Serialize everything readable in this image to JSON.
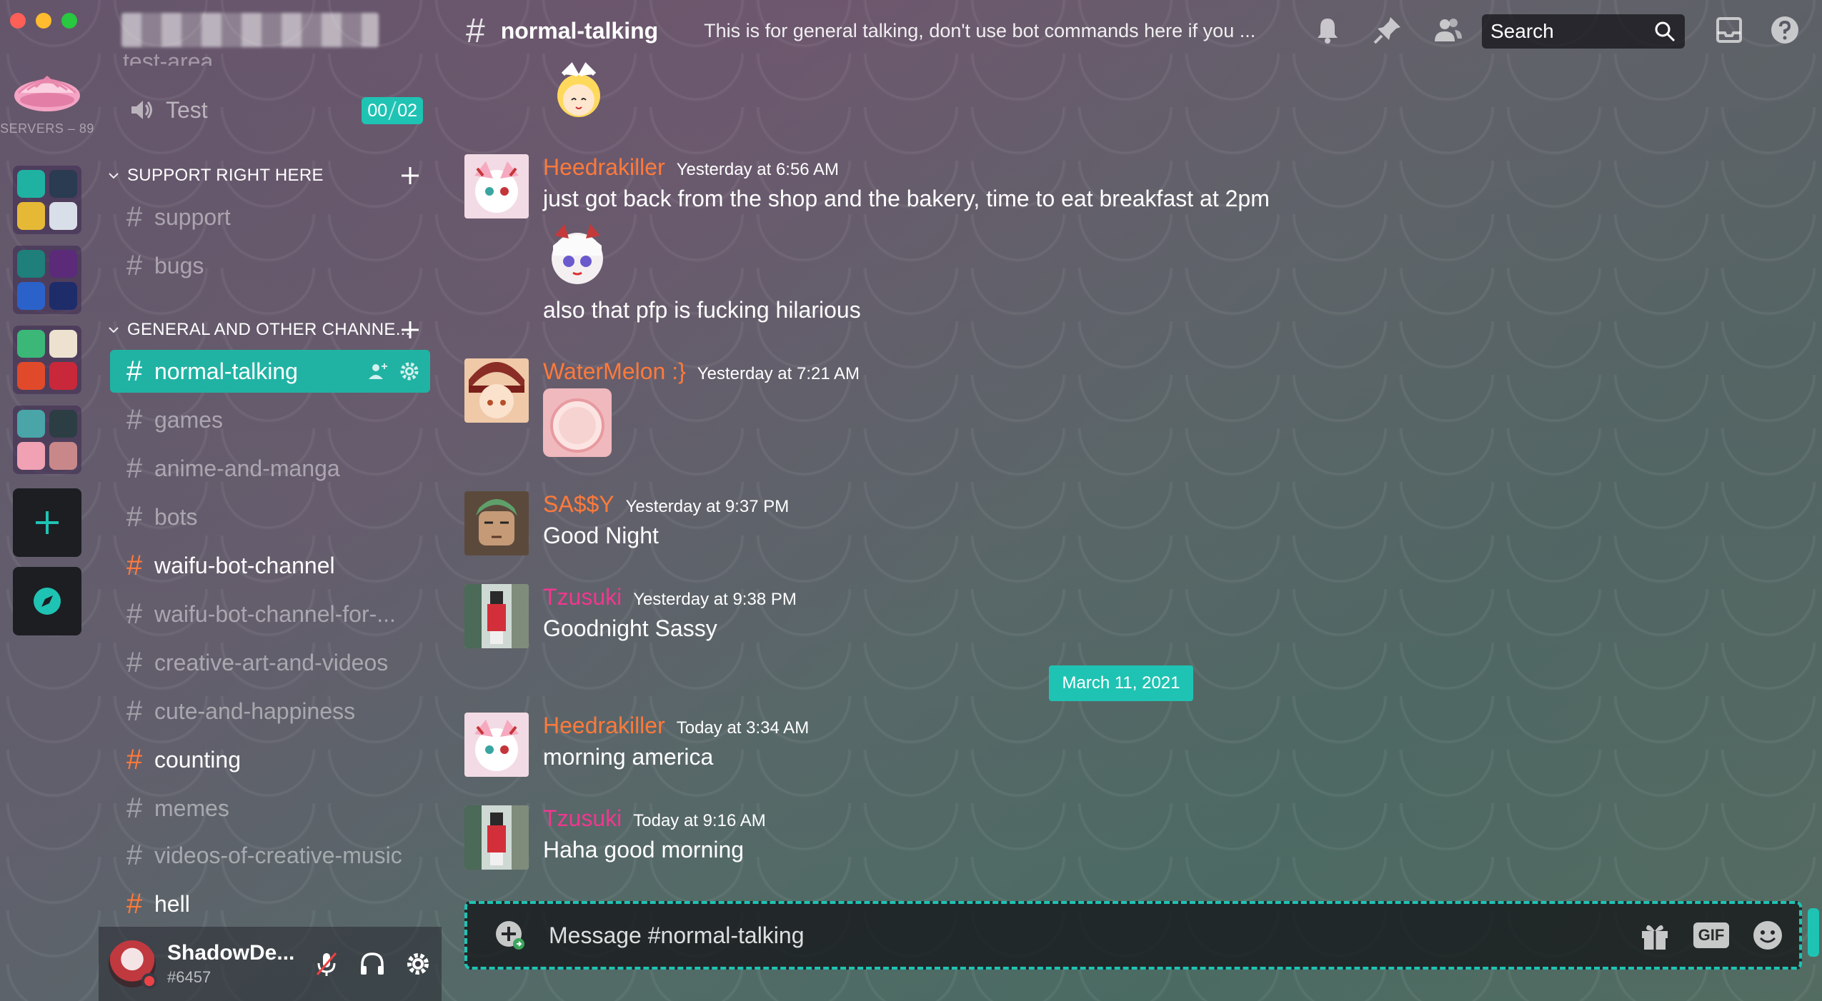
{
  "colors": {
    "accent": "#1fc3b3",
    "unread_hash": "#ff7a3a",
    "status_dnd": "#ed4245"
  },
  "server_rail": {
    "servers_label": "SERVERS – 89"
  },
  "sidebar": {
    "partial_channel": "test-area",
    "voice_channel": {
      "name": "Test",
      "counter_left": "00",
      "counter_right": "02"
    },
    "categories": [
      {
        "label": "SUPPORT RIGHT HERE"
      },
      {
        "label": "GENERAL AND OTHER CHANNE..."
      }
    ],
    "channels": [
      {
        "name": "support"
      },
      {
        "name": "bugs"
      },
      {
        "name": "normal-talking"
      },
      {
        "name": "games"
      },
      {
        "name": "anime-and-manga"
      },
      {
        "name": "bots"
      },
      {
        "name": "waifu-bot-channel"
      },
      {
        "name": "waifu-bot-channel-for-..."
      },
      {
        "name": "creative-art-and-videos"
      },
      {
        "name": "cute-and-happiness"
      },
      {
        "name": "counting"
      },
      {
        "name": "memes"
      },
      {
        "name": "videos-of-creative-music"
      },
      {
        "name": "hell"
      }
    ]
  },
  "user_panel": {
    "username": "ShadowDe...",
    "tag": "#6457"
  },
  "topbar": {
    "title": "normal-talking",
    "topic": "This is for general talking, don't use bot commands here if you ...",
    "search_placeholder": "Search"
  },
  "messages": [
    {
      "author": "Heedrakiller",
      "author_color": "#ff7a3a",
      "timestamp": "Yesterday at 6:56 AM",
      "lines": [
        "just got back from the shop and the bakery, time to eat breakfast at 2pm",
        "also that pfp is fucking hilarious"
      ]
    },
    {
      "author": "WaterMelon :}",
      "author_color": "#ff7a3a",
      "timestamp": "Yesterday at 7:21 AM"
    },
    {
      "author": "SA$$Y",
      "author_color": "#ff7a3a",
      "timestamp": "Yesterday at 9:37 PM",
      "lines": [
        "Good Night"
      ]
    },
    {
      "author": "Tzusuki",
      "author_color": "#f0388f",
      "timestamp": "Yesterday at 9:38 PM",
      "lines": [
        "Goodnight Sassy"
      ]
    },
    {
      "author": "Heedrakiller",
      "author_color": "#ff7a3a",
      "timestamp": "Today at 3:34 AM",
      "lines": [
        "morning america"
      ]
    },
    {
      "author": "Tzusuki",
      "author_color": "#f0388f",
      "timestamp": "Today at 9:16 AM",
      "lines": [
        "Haha good morning"
      ]
    }
  ],
  "date_divider": "March 11, 2021",
  "composer": {
    "placeholder": "Message #normal-talking"
  }
}
